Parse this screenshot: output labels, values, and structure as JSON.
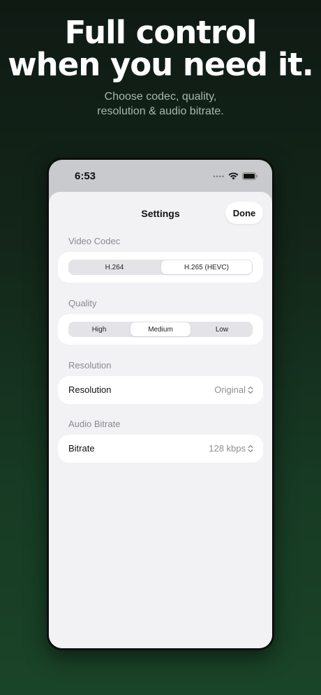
{
  "hero": {
    "title_line1": "Full control",
    "title_line2": "when you need it.",
    "subtitle_line1": "Choose codec, quality,",
    "subtitle_line2": "resolution & audio bitrate."
  },
  "status_bar": {
    "time": "6:53",
    "icons": [
      "signal-dots-icon",
      "wifi-icon",
      "battery-icon"
    ]
  },
  "sheet": {
    "title": "Settings",
    "done_label": "Done"
  },
  "video_codec": {
    "label": "Video Codec",
    "options": [
      "H.264",
      "H.265 (HEVC)"
    ],
    "selected": "H.265 (HEVC)"
  },
  "quality": {
    "label": "Quality",
    "options": [
      "High",
      "Medium",
      "Low"
    ],
    "selected": "Medium"
  },
  "resolution": {
    "section_label": "Resolution",
    "row_label": "Resolution",
    "value": "Original"
  },
  "audio": {
    "section_label": "Audio Bitrate",
    "row_label": "Bitrate",
    "value": "128 kbps"
  },
  "colors": {
    "background_top": "#0f1a13",
    "background_bottom": "#1a4428",
    "sheet": "#f2f2f5"
  }
}
